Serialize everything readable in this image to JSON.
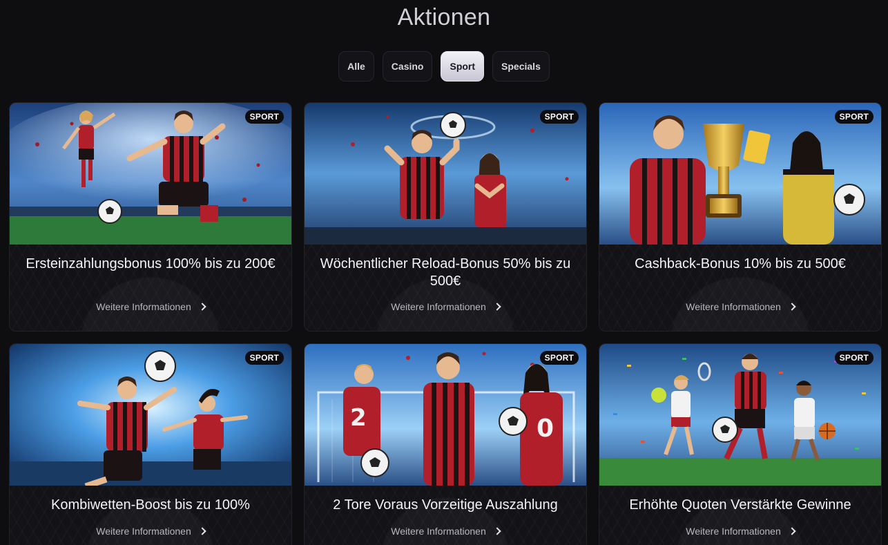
{
  "page": {
    "title": "Aktionen"
  },
  "tabs": [
    {
      "label": "Alle",
      "active": false
    },
    {
      "label": "Casino",
      "active": false
    },
    {
      "label": "Sport",
      "active": true
    },
    {
      "label": "Specials",
      "active": false
    }
  ],
  "cards": [
    {
      "badge": "SPORT",
      "title": "Ersteinzahlungsbonus 100% bis zu 200€",
      "link": "Weitere Informationen",
      "image": "soccer-duo-stadium"
    },
    {
      "badge": "SPORT",
      "title": "Wöchentlicher Reload-Bonus 50% bis zu 500€",
      "link": "Weitere Informationen",
      "image": "soccer-duo-ball-spin"
    },
    {
      "badge": "SPORT",
      "title": "Cashback-Bonus 10% bis zu 500€",
      "link": "Weitere Informationen",
      "image": "trophy-player-referee"
    },
    {
      "badge": "SPORT",
      "title": "Kombiwetten-Boost bis zu 100%",
      "link": "Weitere Informationen",
      "image": "soccer-headers"
    },
    {
      "badge": "SPORT",
      "title": "2 Tore Voraus Vorzeitige Auszahlung",
      "link": "Weitere Informationen",
      "image": "soccer-trio-goal"
    },
    {
      "badge": "SPORT",
      "title": "Erhöhte Quoten Verstärkte Gewinne",
      "link": "Weitere Informationen",
      "image": "multi-sport-athletes"
    }
  ],
  "colors": {
    "background": "#0e0d10",
    "card": "#131216",
    "tab_active": "#e6e4ee",
    "jersey_red": "#b01f2a",
    "jersey_dark": "#1b1214"
  }
}
